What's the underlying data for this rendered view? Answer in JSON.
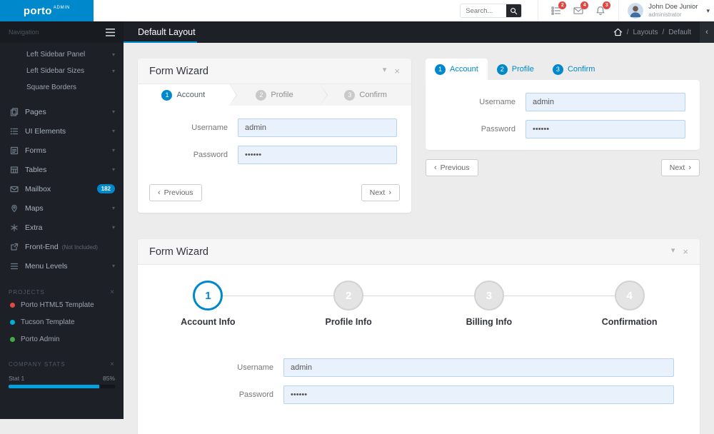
{
  "brand": {
    "name": "porto",
    "sub": "ADMIN"
  },
  "header": {
    "search": {
      "placeholder": "Search..."
    },
    "notifications": [
      {
        "name": "tasks",
        "count": "2"
      },
      {
        "name": "messages",
        "count": "4"
      },
      {
        "name": "alerts",
        "count": "3"
      }
    ],
    "user": {
      "name": "John Doe Junior",
      "role": "administrator"
    }
  },
  "page_header": {
    "title": "Default Layout",
    "breadcrumb": {
      "sep": "/",
      "items": [
        "Layouts",
        "Default"
      ]
    }
  },
  "sidebar": {
    "section_label": "Navigation",
    "items": [
      {
        "label": "Left Sidebar Panel"
      },
      {
        "label": "Left Sidebar Sizes"
      },
      {
        "label": "Square Borders"
      },
      {
        "label": "Pages"
      },
      {
        "label": "UI Elements"
      },
      {
        "label": "Forms"
      },
      {
        "label": "Tables"
      },
      {
        "label": "Mailbox",
        "badge": "182"
      },
      {
        "label": "Maps"
      },
      {
        "label": "Extra"
      },
      {
        "label": "Front-End",
        "note": "(Not Included)"
      },
      {
        "label": "Menu Levels"
      }
    ],
    "projects": {
      "label": "PROJECTS",
      "items": [
        {
          "label": "Porto HTML5 Template",
          "color": "#e24b3f"
        },
        {
          "label": "Tucson Template",
          "color": "#00b0d8"
        },
        {
          "label": "Porto Admin",
          "color": "#41ad41"
        }
      ]
    },
    "company_stats": {
      "label": "COMPANY STATS",
      "stat_label": "Stat 1",
      "stat_value": "85%",
      "stat_pct": 85,
      "bar_color": "#00a3e0"
    }
  },
  "wizard_arrows": {
    "title": "Form Wizard",
    "steps": [
      {
        "num": "1",
        "label": "Account"
      },
      {
        "num": "2",
        "label": "Profile"
      },
      {
        "num": "3",
        "label": "Confirm"
      }
    ],
    "form": {
      "username_label": "Username",
      "username_value": "admin",
      "password_label": "Password",
      "password_value": "••••••"
    },
    "prev_label": "Previous",
    "next_label": "Next"
  },
  "wizard_tabs": {
    "steps": [
      {
        "num": "1",
        "label": "Account"
      },
      {
        "num": "2",
        "label": "Profile"
      },
      {
        "num": "3",
        "label": "Confirm"
      }
    ],
    "form": {
      "username_label": "Username",
      "username_value": "admin",
      "password_label": "Password",
      "password_value": "••••••"
    },
    "prev_label": "Previous",
    "next_label": "Next"
  },
  "wizard_circles": {
    "title": "Form Wizard",
    "steps": [
      {
        "num": "1",
        "label": "Account Info"
      },
      {
        "num": "2",
        "label": "Profile Info"
      },
      {
        "num": "3",
        "label": "Billing Info"
      },
      {
        "num": "4",
        "label": "Confirmation"
      }
    ],
    "form": {
      "username_label": "Username",
      "username_value": "admin",
      "password_label": "Password",
      "password_value": "••••••"
    }
  },
  "ui": {
    "caret_down": "▾",
    "close": "×",
    "chevron_left": "‹",
    "chevron_right": "›"
  },
  "colors": {
    "accent": "#0088cc",
    "sidebar_bg": "#1d2127",
    "badge_red": "#e04642"
  }
}
